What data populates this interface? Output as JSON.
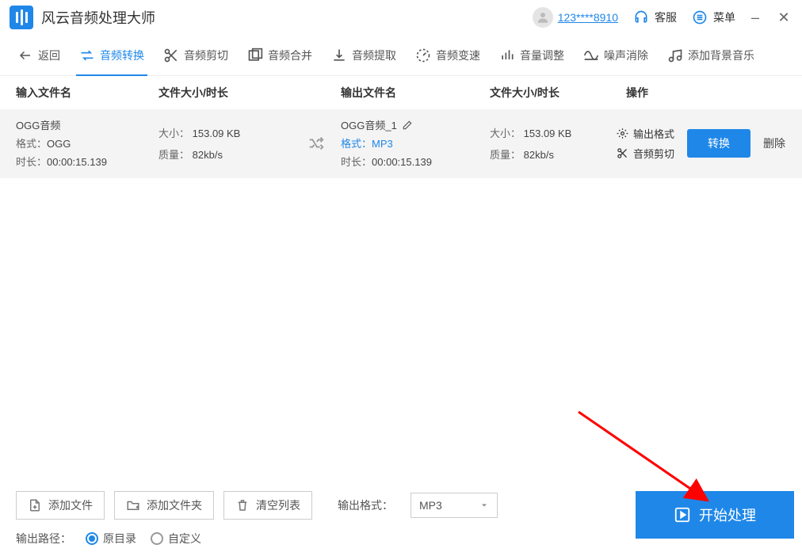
{
  "titlebar": {
    "app_title": "风云音频处理大师",
    "user_id": "123****8910",
    "support": "客服",
    "menu": "菜单"
  },
  "nav": {
    "back": "返回",
    "items": [
      "音频转换",
      "音频剪切",
      "音频合并",
      "音频提取",
      "音频变速",
      "音量调整",
      "噪声消除",
      "添加背景音乐"
    ]
  },
  "table": {
    "headers": {
      "input_name": "输入文件名",
      "size_dur1": "文件大小/时长",
      "output_name": "输出文件名",
      "size_dur2": "文件大小/时长",
      "ops": "操作"
    },
    "row": {
      "in_name": "OGG音频",
      "in_format_label": "格式：",
      "in_format": "OGG",
      "in_dur_label": "时长：",
      "in_dur": "00:00:15.139",
      "size_label": "大小：",
      "size": "153.09 KB",
      "quality_label": "质量：",
      "quality": "82kb/s",
      "out_name": "OGG音频_1",
      "out_format_label": "格式：",
      "out_format": "MP3",
      "out_dur_label": "时长：",
      "out_dur": "00:00:15.139",
      "size2": "153.09 KB",
      "quality2": "82kb/s",
      "op_format": "输出格式",
      "op_cut": "音频剪切",
      "convert": "转换",
      "delete": "删除"
    }
  },
  "bottom": {
    "add_file": "添加文件",
    "add_folder": "添加文件夹",
    "clear_list": "清空列表",
    "output_format_label": "输出格式：",
    "output_format": "MP3",
    "start": "开始处理",
    "path_label": "输出路径：",
    "path_original": "原目录",
    "path_custom": "自定义"
  }
}
